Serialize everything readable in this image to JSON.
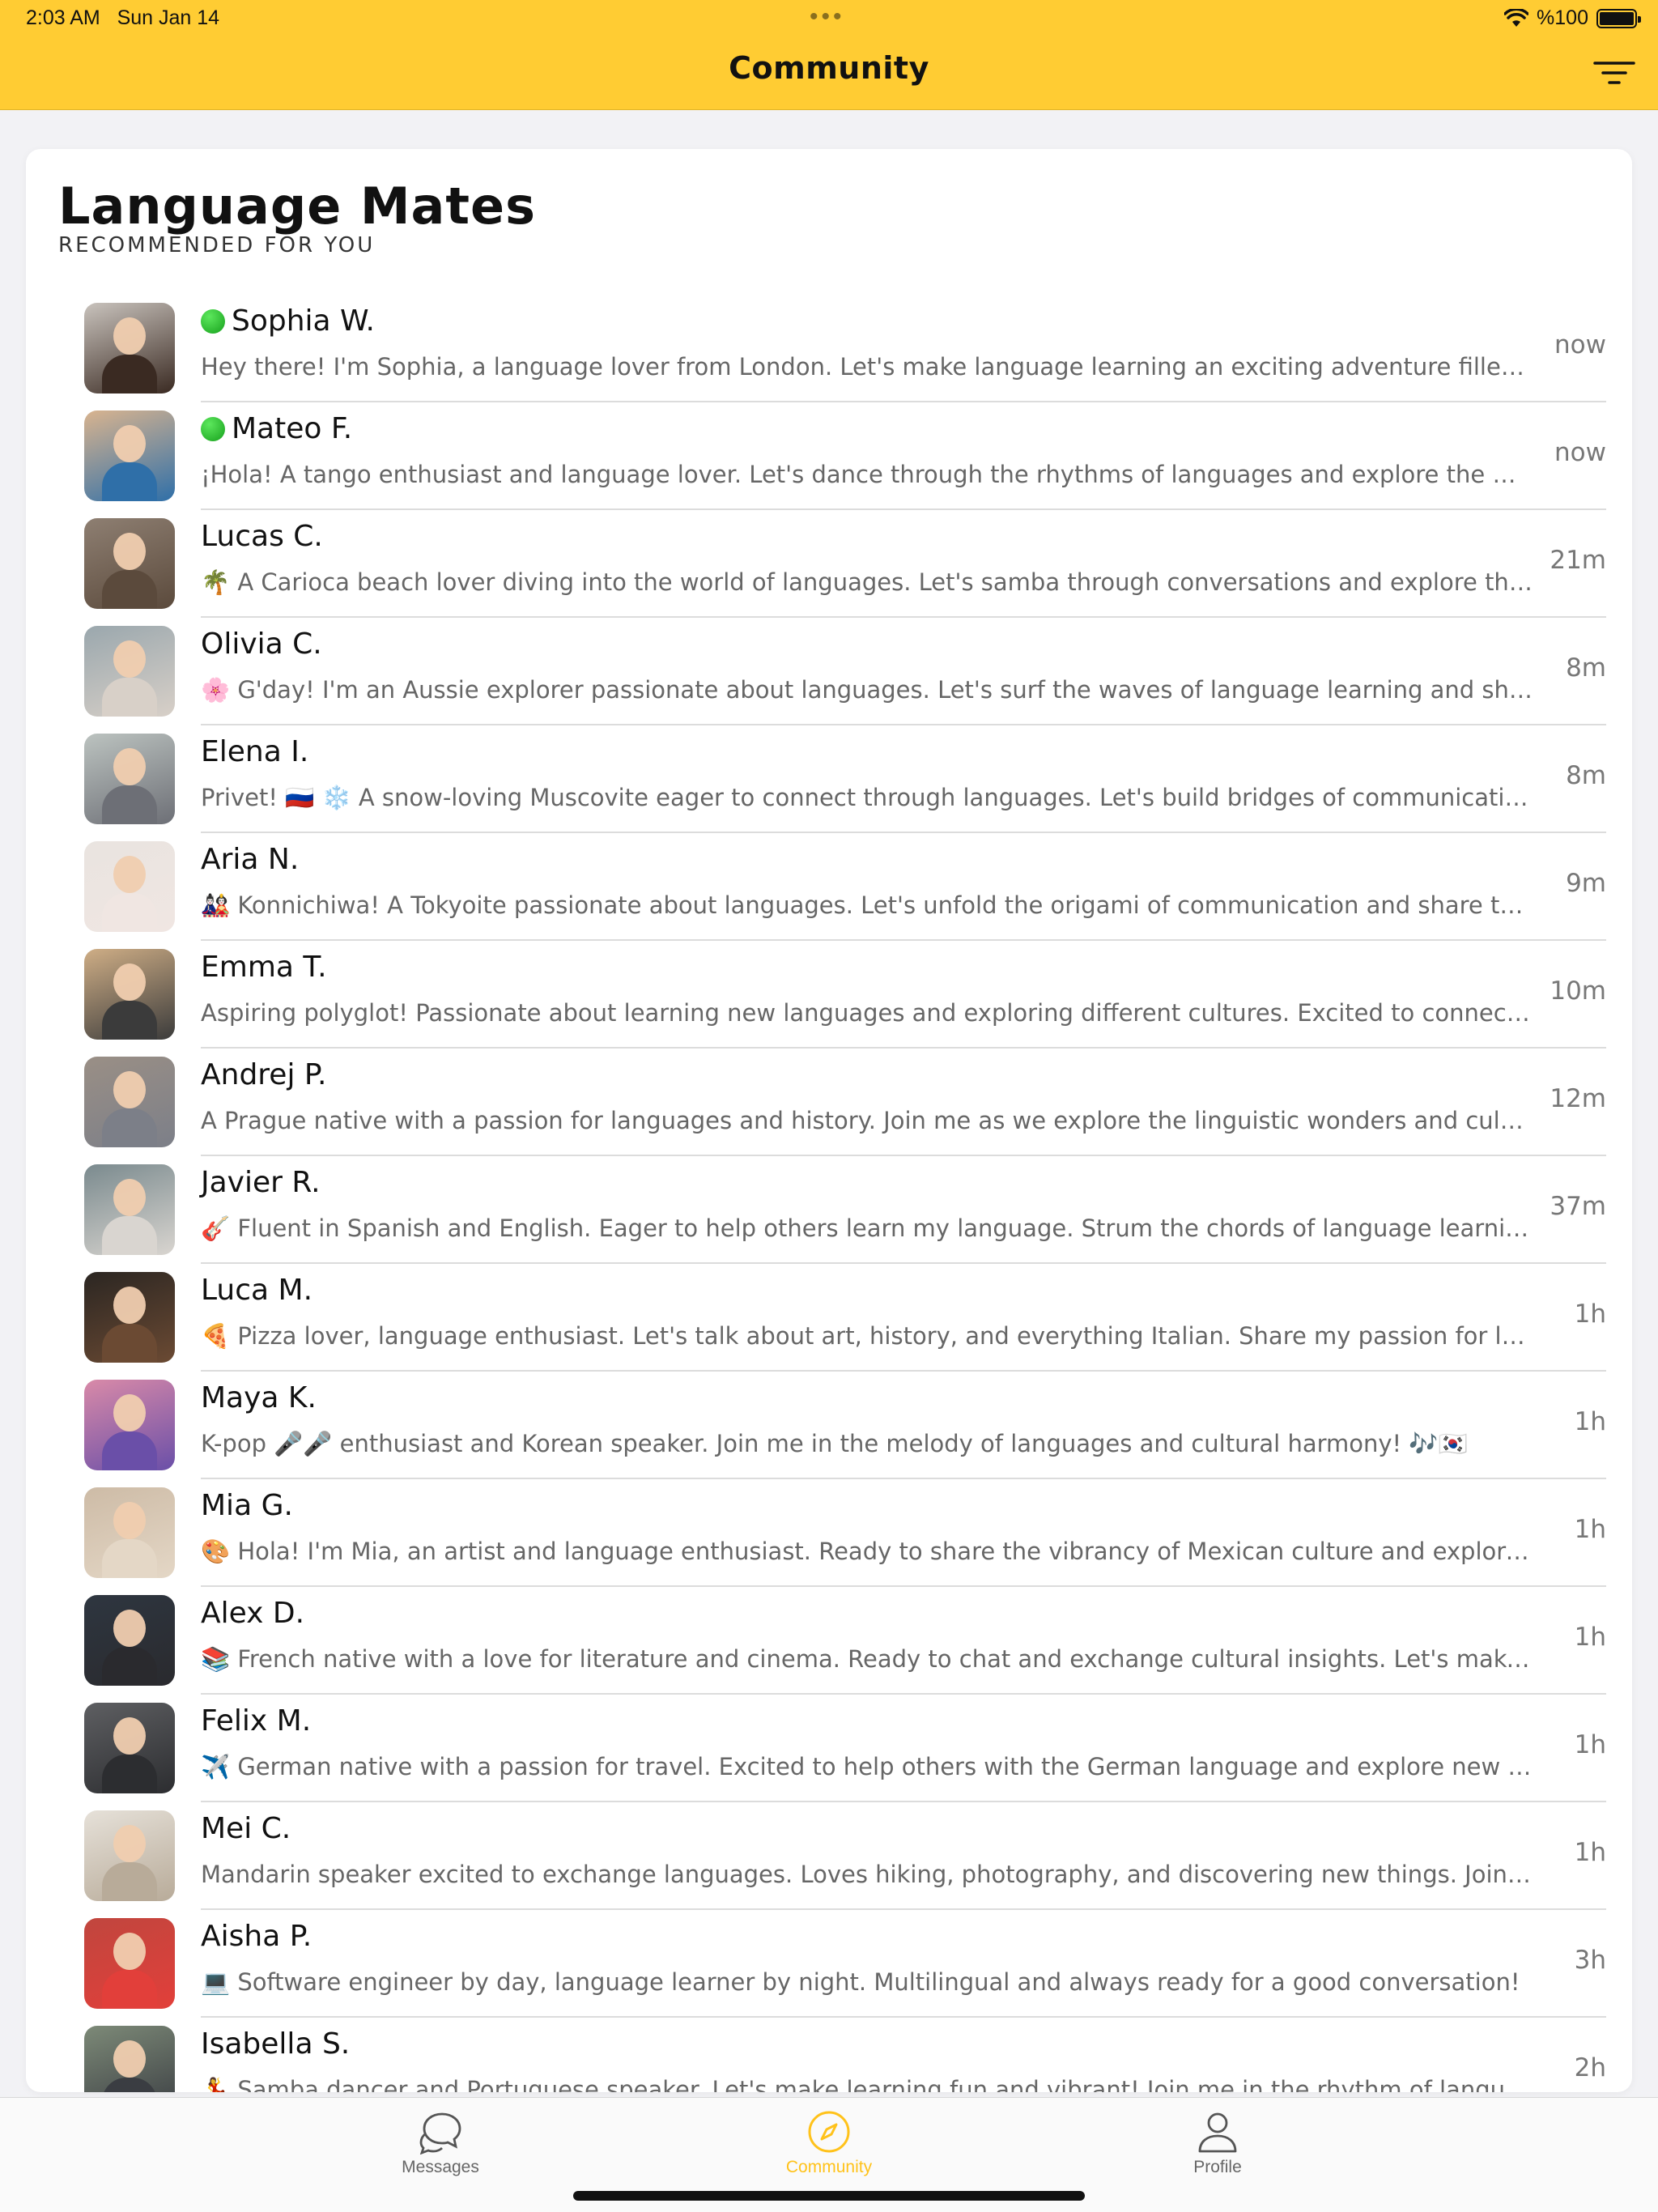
{
  "status_bar": {
    "time": "2:03 AM",
    "date": "Sun Jan 14",
    "battery": "%100"
  },
  "header": {
    "title": "Community",
    "filter_icon": "filter-lines-icon"
  },
  "section": {
    "title": "Language Mates",
    "subtitle": "RECOMMENDED FOR YOU"
  },
  "mates": [
    {
      "name": "Sophia W.",
      "online": true,
      "bio": "Hey there! I'm Sophia, a language lover from London. Let's make language learning an exciting adventure filled with fun and friendship!",
      "time": "now"
    },
    {
      "name": "Mateo F.",
      "online": true,
      "bio": "¡Hola! A tango enthusiast and language lover. Let's dance through the rhythms of languages and explore the world together!",
      "time": "now"
    },
    {
      "name": "Lucas C.",
      "online": false,
      "bio": "🌴 A Carioca beach lover diving into the world of languages. Let's samba through conversations and explore the world!",
      "time": "21m"
    },
    {
      "name": "Olivia C.",
      "online": false,
      "bio": "🌸 G'day! I'm an Aussie explorer passionate about languages. Let's surf the waves of language learning and share stories!",
      "time": "8m"
    },
    {
      "name": "Elena I.",
      "online": false,
      "bio": "Privet! 🇷🇺 ❄️ A snow-loving Muscovite eager to connect through languages. Let's build bridges of communication together!",
      "time": "8m"
    },
    {
      "name": "Aria N.",
      "online": false,
      "bio": "🎎 Konnichiwa! A Tokyoite passionate about languages. Let's unfold the origami of communication and share traditions!",
      "time": "9m"
    },
    {
      "name": "Emma T.",
      "online": false,
      "bio": "Aspiring polyglot! Passionate about learning new languages and exploring different cultures. Excited to connect with you!",
      "time": "10m"
    },
    {
      "name": "Andrej P.",
      "online": false,
      "bio": "A Prague native with a passion for languages and history. Join me as we explore the linguistic wonders and culture of Europe!",
      "time": "12m"
    },
    {
      "name": "Javier R.",
      "online": false,
      "bio": "🎸 Fluent in Spanish and English. Eager to help others learn my language. Strum the chords of language learning with me!",
      "time": "37m"
    },
    {
      "name": "Luca M.",
      "online": false,
      "bio": "🍕 Pizza lover, language enthusiast. Let's talk about art, history, and everything Italian. Share my passion for languages!",
      "time": "1h"
    },
    {
      "name": "Maya K.",
      "online": false,
      "bio": "K-pop 🎤🎤 enthusiast and Korean speaker. Join me in the melody of languages and cultural harmony! 🎶🇰🇷",
      "time": "1h"
    },
    {
      "name": "Mia G.",
      "online": false,
      "bio": "🎨 Hola! I'm Mia, an artist and language enthusiast. Ready to share the vibrancy of Mexican culture and explore yours!",
      "time": "1h"
    },
    {
      "name": "Alex D.",
      "online": false,
      "bio": "📚 French native with a love for literature and cinema. Ready to chat and exchange cultural insights. Let's make friends!",
      "time": "1h"
    },
    {
      "name": "Felix M.",
      "online": false,
      "bio": "✈️ German native with a passion for travel. Excited to help others with the German language and explore new lands!",
      "time": "1h"
    },
    {
      "name": "Mei C.",
      "online": false,
      "bio": "Mandarin speaker excited to exchange languages. Loves hiking, photography, and discovering new things. Join me on this journey!",
      "time": "1h"
    },
    {
      "name": "Aisha P.",
      "online": false,
      "bio": "💻 Software engineer by day, language learner by night. Multilingual and always ready for a good conversation!",
      "time": "3h"
    },
    {
      "name": "Isabella S.",
      "online": false,
      "bio": "💃 Samba dancer and Portuguese speaker. Let's make learning fun and vibrant! Join me in the rhythm of languages!",
      "time": "2h"
    }
  ],
  "tabs": [
    {
      "label": "Messages",
      "icon": "chat-bubbles-icon",
      "active": false
    },
    {
      "label": "Community",
      "icon": "compass-icon",
      "active": true
    },
    {
      "label": "Profile",
      "icon": "person-icon",
      "active": false
    }
  ],
  "colors": {
    "header": "#ffcc33",
    "active_tab": "#ffc21a",
    "online": "#22b02a"
  }
}
